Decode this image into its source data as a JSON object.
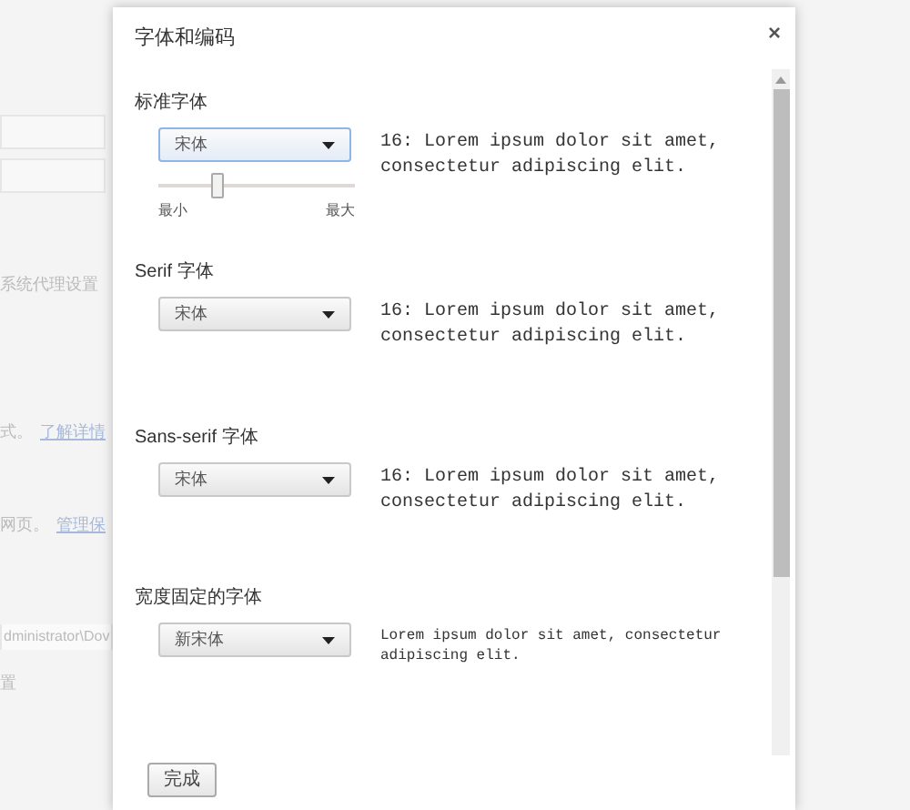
{
  "background_page": {
    "lines": [
      {
        "kind": "text",
        "text": "系统代理设置"
      },
      {
        "kind": "link_row",
        "text": "式。",
        "link": "了解详情"
      },
      {
        "kind": "link_row",
        "text": "网页。",
        "link": "管理保"
      },
      {
        "kind": "field",
        "text": "dministrator\\Dov"
      },
      {
        "kind": "text",
        "text": "置"
      }
    ]
  },
  "dialog": {
    "title": "字体和编码",
    "close": "×",
    "sections": [
      {
        "kind": "slider",
        "heading": "标准字体",
        "font": "宋体",
        "focused": true,
        "level": 0.3,
        "min_label": "最小",
        "max_label": "最大",
        "preview": [
          "16: Lorem ipsum dolor sit amet,",
          "consectetur adipiscing elit."
        ],
        "small_preview": false
      },
      {
        "kind": "plain",
        "heading": "Serif 字体",
        "font": "宋体",
        "focused": false,
        "preview": [
          "16: Lorem ipsum dolor sit amet,",
          "consectetur adipiscing elit."
        ],
        "small_preview": false
      },
      {
        "kind": "plain",
        "heading": "Sans-serif 字体",
        "font": "宋体",
        "focused": false,
        "preview": [
          "16: Lorem ipsum dolor sit amet,",
          "consectetur adipiscing elit."
        ],
        "small_preview": false
      },
      {
        "kind": "plain",
        "heading": "宽度固定的字体",
        "font": "新宋体",
        "focused": false,
        "preview": [
          "Lorem ipsum dolor sit amet, consectetur",
          "adipiscing elit."
        ],
        "small_preview": true
      }
    ],
    "done_button": "完成"
  }
}
